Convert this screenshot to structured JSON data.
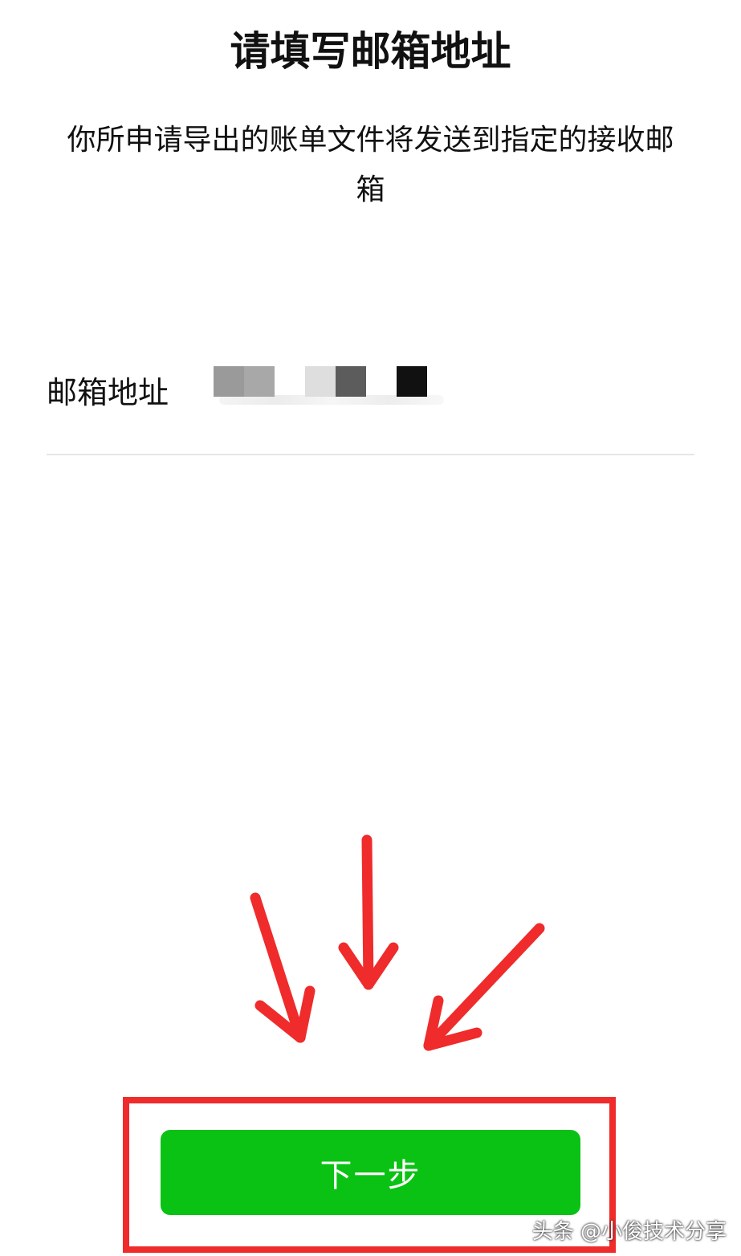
{
  "header": {
    "title": "请填写邮箱地址",
    "description": "你所申请导出的账单文件将发送到指定的接收邮箱"
  },
  "form": {
    "email_label": "邮箱地址",
    "email_value_state": "redacted"
  },
  "footer": {
    "next_label": "下一步"
  },
  "overlay": {
    "arrow_color": "#ef2b2b",
    "highlight_color": "#ef2b2b",
    "watermark": "头条 @小俊技术分享"
  },
  "colors": {
    "primary_button": "#0ac213",
    "background": "#ffffff",
    "text": "#111111"
  }
}
